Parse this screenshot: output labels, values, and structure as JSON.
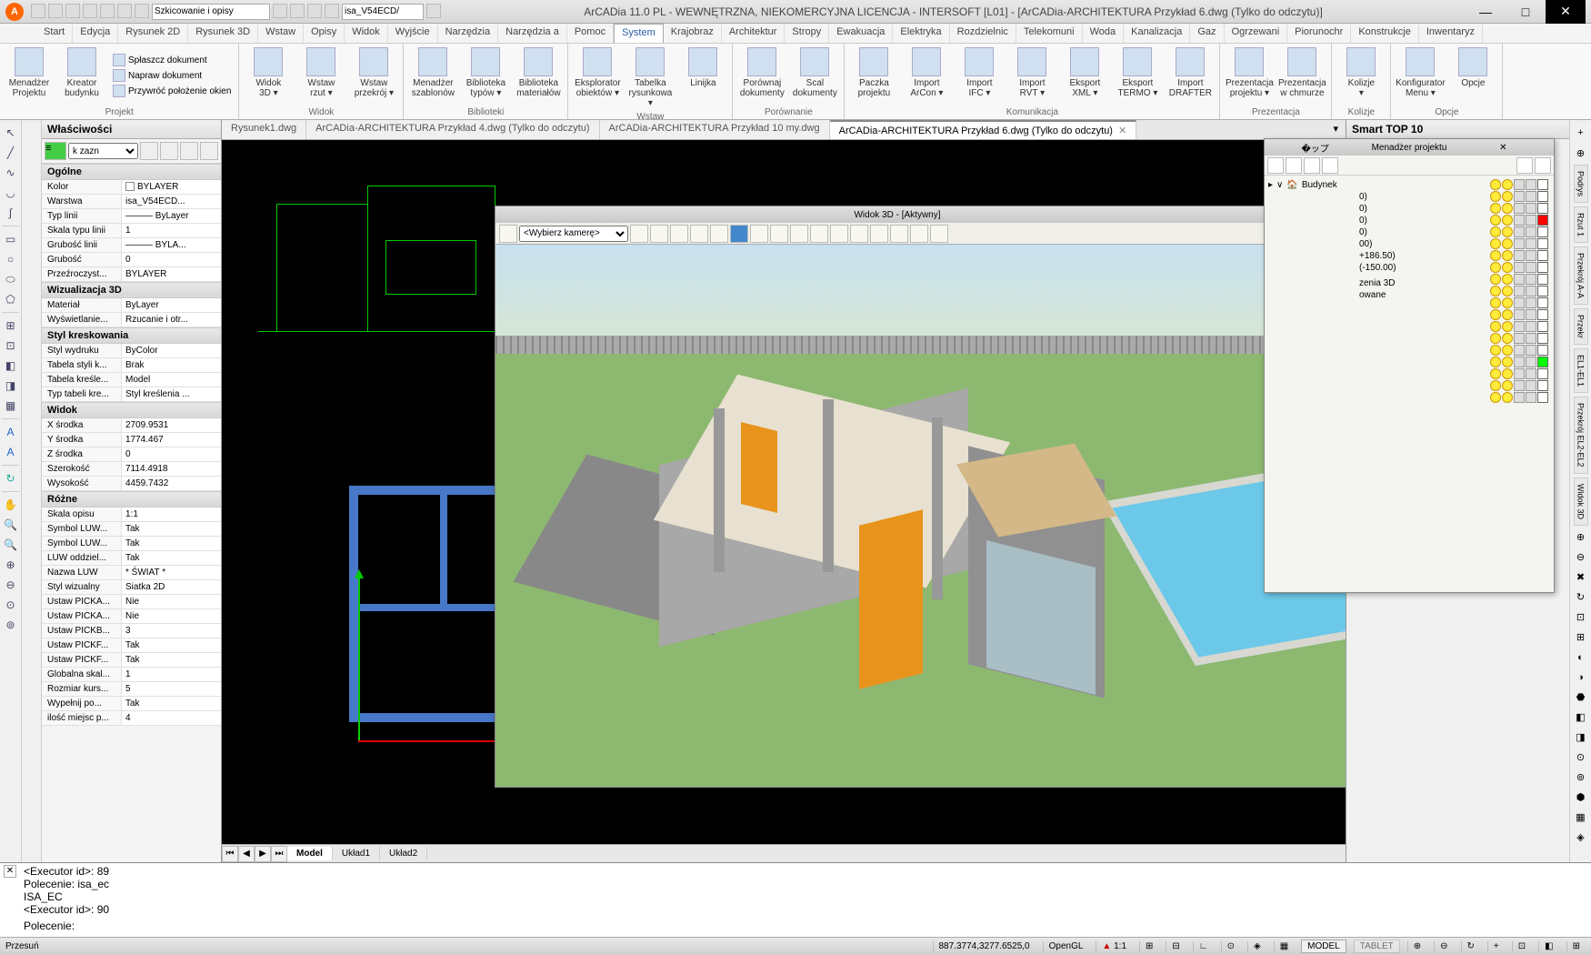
{
  "app": {
    "title": "ArCADia 11.0 PL - WEWNĘTRZNA, NIEKOMERCYJNA LICENCJA - INTERSOFT [L01] - [ArCADia-ARCHITEKTURA Przykład 6.dwg (Tylko do odczytu)]",
    "qat_combo1": "Szkicowanie i opisy",
    "qat_combo2": "isa_V54ECD/"
  },
  "tabs": [
    "Start",
    "Edycja",
    "Rysunek 2D",
    "Rysunek 3D",
    "Wstaw",
    "Opisy",
    "Widok",
    "Wyjście",
    "Narzędzia",
    "Narzędzia a",
    "Pomoc",
    "System",
    "Krajobraz",
    "Architektur",
    "Stropy",
    "Ewakuacja",
    "Elektryka",
    "Rozdzielnic",
    "Telekomuni",
    "Woda",
    "Kanalizacja",
    "Gaz",
    "Ogrzewani",
    "Piorunochr",
    "Konstrukcje",
    "Inwentaryz"
  ],
  "active_tab": "System",
  "ribbon": {
    "groups": [
      {
        "label": "Projekt",
        "large": [
          {
            "t": "Menadżer\nProjektu"
          },
          {
            "t": "Kreator\nbudynku"
          }
        ],
        "small": [
          "Spłaszcz dokument",
          "Napraw dokument",
          "Przywróć położenie okien"
        ]
      },
      {
        "label": "Widok",
        "large": [
          {
            "t": "Widok\n3D ▾"
          },
          {
            "t": "Wstaw\nrzut ▾"
          },
          {
            "t": "Wstaw\nprzekrój ▾"
          }
        ]
      },
      {
        "label": "Biblioteki",
        "large": [
          {
            "t": "Menadżer\nszablonów"
          },
          {
            "t": "Biblioteka\ntypów ▾"
          },
          {
            "t": "Biblioteka\nmateriałów"
          }
        ]
      },
      {
        "label": "Wstaw",
        "large": [
          {
            "t": "Eksplorator\nobiektów ▾"
          },
          {
            "t": "Tabelka\nrysunkowa ▾"
          },
          {
            "t": "Linijka"
          }
        ]
      },
      {
        "label": "Porównanie",
        "large": [
          {
            "t": "Porównaj\ndokumenty"
          },
          {
            "t": "Scal\ndokumenty"
          }
        ]
      },
      {
        "label": "Komunikacja",
        "large": [
          {
            "t": "Paczka\nprojektu"
          },
          {
            "t": "Import\nArCon ▾"
          },
          {
            "t": "Import\nIFC ▾"
          },
          {
            "t": "Import\nRVT ▾"
          },
          {
            "t": "Eksport\nXML ▾"
          },
          {
            "t": "Eksport\nTERMO ▾"
          },
          {
            "t": "Import\nDRAFTER"
          }
        ]
      },
      {
        "label": "Prezentacja",
        "large": [
          {
            "t": "Prezentacja\nprojektu ▾"
          },
          {
            "t": "Prezentacja\nw chmurze"
          }
        ]
      },
      {
        "label": "Kolizje",
        "large": [
          {
            "t": "Kolizje\n▾"
          }
        ]
      },
      {
        "label": "Opcje",
        "large": [
          {
            "t": "Konfigurator\nMenu ▾"
          },
          {
            "t": "Opcje"
          }
        ]
      }
    ]
  },
  "doc_tabs": [
    {
      "label": "Rysunek1.dwg",
      "active": false
    },
    {
      "label": "ArCADia-ARCHITEKTURA Przykład 4.dwg (Tylko do odczytu)",
      "active": false
    },
    {
      "label": "ArCADia-ARCHITEKTURA Przykład 10 my.dwg",
      "active": false
    },
    {
      "label": "ArCADia-ARCHITEKTURA Przykład 6.dwg (Tylko do odczytu)",
      "active": true
    }
  ],
  "props": {
    "title": "Właściwości",
    "selector": "k zazn",
    "sections": [
      {
        "h": "Ogólne",
        "rows": [
          {
            "n": "Kolor",
            "v": "BYLAYER",
            "swatch": true
          },
          {
            "n": "Warstwa",
            "v": "isa_V54ECD..."
          },
          {
            "n": "Typ linii",
            "v": "——— ByLayer"
          },
          {
            "n": "Skala typu linii",
            "v": "1"
          },
          {
            "n": "Grubość linii",
            "v": "——— BYLA..."
          },
          {
            "n": "Grubość",
            "v": "0"
          },
          {
            "n": "Przeźroczyst...",
            "v": "BYLAYER"
          }
        ]
      },
      {
        "h": "Wizualizacja 3D",
        "rows": [
          {
            "n": "Materiał",
            "v": "ByLayer"
          },
          {
            "n": "Wyświetlanie...",
            "v": "Rzucanie i otr..."
          }
        ]
      },
      {
        "h": "Styl kreskowania",
        "rows": [
          {
            "n": "Styl wydruku",
            "v": "ByColor"
          },
          {
            "n": "Tabela styli k...",
            "v": "Brak"
          },
          {
            "n": "Tabela kreśle...",
            "v": "Model"
          },
          {
            "n": "Typ tabeli kre...",
            "v": "Styl kreślenia ..."
          }
        ]
      },
      {
        "h": "Widok",
        "rows": [
          {
            "n": "X środka",
            "v": "2709.9531"
          },
          {
            "n": "Y środka",
            "v": "1774.467"
          },
          {
            "n": "Z środka",
            "v": "0"
          },
          {
            "n": "Szerokość",
            "v": "7114.4918"
          },
          {
            "n": "Wysokość",
            "v": "4459.7432"
          }
        ]
      },
      {
        "h": "Różne",
        "rows": [
          {
            "n": "Skala opisu",
            "v": "1:1"
          },
          {
            "n": "Symbol LUW...",
            "v": "Tak"
          },
          {
            "n": "Symbol LUW...",
            "v": "Tak"
          },
          {
            "n": "LUW oddziel...",
            "v": "Tak"
          },
          {
            "n": "Nazwa LUW",
            "v": "* ŚWIAT *"
          },
          {
            "n": "Styl wizualny",
            "v": "Siatka 2D"
          },
          {
            "n": "Ustaw PICKA...",
            "v": "Nie"
          },
          {
            "n": "Ustaw PICKA...",
            "v": "Nie"
          },
          {
            "n": "Ustaw PICKB...",
            "v": "3"
          },
          {
            "n": "Ustaw PICKF...",
            "v": "Tak"
          },
          {
            "n": "Ustaw PICKF...",
            "v": "Tak"
          },
          {
            "n": "Globalna skal...",
            "v": "1"
          },
          {
            "n": "Rozmiar kurs...",
            "v": "5"
          },
          {
            "n": "Wypełnij po...",
            "v": "Tak"
          },
          {
            "n": "ilość miejsc p...",
            "v": "4"
          }
        ]
      }
    ]
  },
  "layout_tabs": [
    "Model",
    "Układ1",
    "Układ2"
  ],
  "active_layout": "Model",
  "smart_panel": "Smart TOP 10",
  "proj_mgr": {
    "title": "Menadżer projektu",
    "root": "Budynek",
    "items": [
      "0)",
      "0)",
      "0)",
      "0)",
      "00)",
      "+186.50)",
      "(-150.00)",
      "",
      "",
      "zenia 3D",
      "owane"
    ],
    "swatches": [
      "#ffffff",
      "#ffffff",
      "#ffffff",
      "#ff0000",
      "#ffffff",
      "#ffffff",
      "#ffffff",
      "#ffffff",
      "#ffffff",
      "#ffffff",
      "#ffffff",
      "#ffffff",
      "#ffffff",
      "#ffffff",
      "#ffffff",
      "#00ff00",
      "#ffffff",
      "#ffffff",
      "#ffffff"
    ]
  },
  "view3d": {
    "title": "Widok 3D - [Aktywny]",
    "camera": "<Wybierz kamerę>"
  },
  "right_vtabs": [
    "Podrys",
    "Rzut 1",
    "Przekrój A-A",
    "Przekr",
    "EL1-EL1",
    "Przekrój EL2-EL2",
    "Widok 3D"
  ],
  "cmd": {
    "lines": "<Executor id>: 89\nPolecenie: isa_ec\nISA_EC\n<Executor id>: 90",
    "prompt": "Polecenie:"
  },
  "status": {
    "left": "Przesuń",
    "coords": "887.3774,3277.6525,0",
    "opengl": "OpenGL",
    "scale": "1:1",
    "model": "MODEL",
    "tablet": "TABLET"
  }
}
